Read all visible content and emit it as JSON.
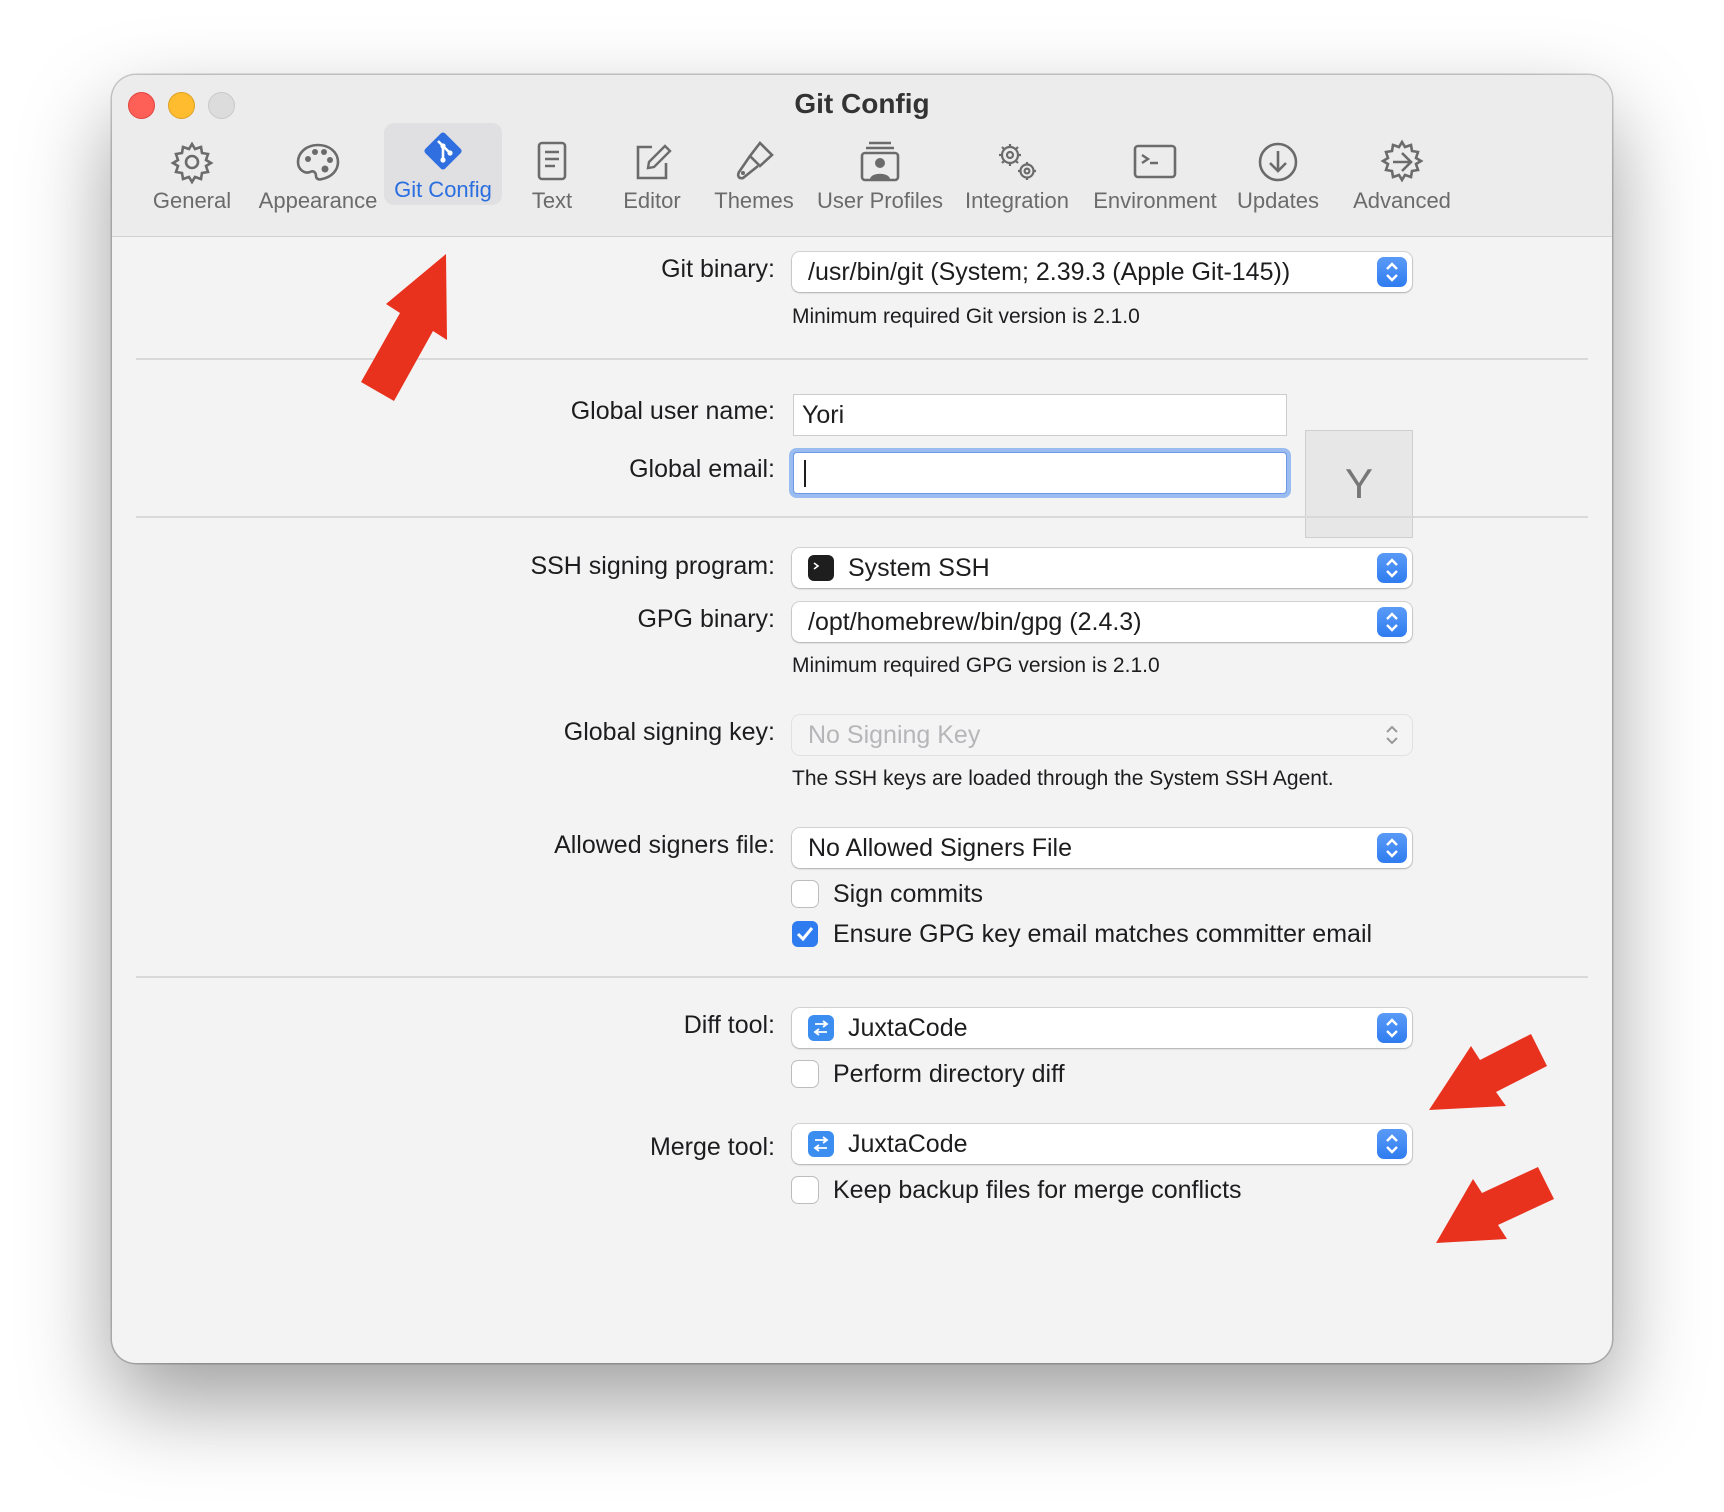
{
  "window": {
    "title": "Git Config"
  },
  "toolbar": {
    "tabs": [
      {
        "label": "General",
        "icon": "gear-icon"
      },
      {
        "label": "Appearance",
        "icon": "palette-icon"
      },
      {
        "label": "Git Config",
        "icon": "git-icon",
        "active": true
      },
      {
        "label": "Text",
        "icon": "document-icon"
      },
      {
        "label": "Editor",
        "icon": "edit-icon"
      },
      {
        "label": "Themes",
        "icon": "brush-icon"
      },
      {
        "label": "User Profiles",
        "icon": "user-profiles-icon"
      },
      {
        "label": "Integration",
        "icon": "gears-icon"
      },
      {
        "label": "Environment",
        "icon": "terminal-icon"
      },
      {
        "label": "Updates",
        "icon": "download-icon"
      },
      {
        "label": "Advanced",
        "icon": "advanced-gear-icon"
      }
    ]
  },
  "git": {
    "binary_label": "Git binary:",
    "binary_value": "/usr/bin/git (System; 2.39.3 (Apple Git-145))",
    "binary_note": "Minimum required Git version is 2.1.0"
  },
  "identity": {
    "user_name_label": "Global user name:",
    "user_name_value": "Yori",
    "email_label": "Global email:",
    "email_value": "",
    "avatar_initial": "Y"
  },
  "signing": {
    "ssh_program_label": "SSH signing program:",
    "ssh_program_value": "System SSH",
    "gpg_binary_label": "GPG binary:",
    "gpg_binary_value": "/opt/homebrew/bin/gpg (2.4.3)",
    "gpg_note": "Minimum required GPG version is 2.1.0",
    "signing_key_label": "Global signing key:",
    "signing_key_value": "No Signing Key",
    "signing_key_note": "The SSH keys are loaded through the System SSH Agent.",
    "allowed_signers_label": "Allowed signers file:",
    "allowed_signers_value": "No Allowed Signers File",
    "sign_commits_label": "Sign commits",
    "sign_commits_checked": false,
    "ensure_email_label": "Ensure GPG key email matches committer email",
    "ensure_email_checked": true
  },
  "tools": {
    "diff_label": "Diff tool:",
    "diff_value": "JuxtaCode",
    "directory_diff_label": "Perform directory diff",
    "directory_diff_checked": false,
    "merge_label": "Merge tool:",
    "merge_value": "JuxtaCode",
    "keep_backup_label": "Keep backup files for merge conflicts",
    "keep_backup_checked": false
  },
  "colors": {
    "accent": "#2f7cf0",
    "annotation_arrow": "#e8321e",
    "traffic_close": "#fe5f57",
    "traffic_minimize": "#febc2e"
  }
}
